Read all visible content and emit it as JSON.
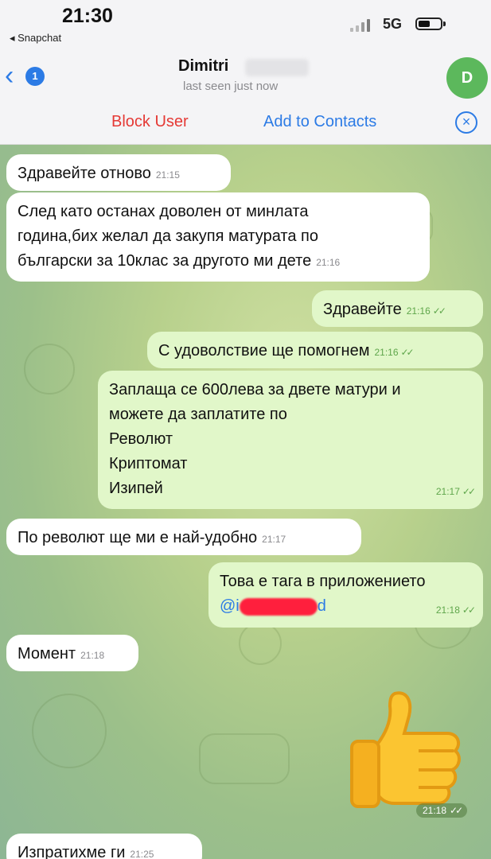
{
  "status_bar": {
    "time": "21:30",
    "back_app": "◂ Snapchat",
    "network": "5G"
  },
  "header": {
    "back_badge": "1",
    "contact_name": "Dimitri",
    "last_seen": "last seen just now",
    "avatar_initial": "D"
  },
  "actions": {
    "block_user": "Block User",
    "add_to_contacts": "Add to Contacts"
  },
  "messages": [
    {
      "direction": "in",
      "text": "Здравейте отново",
      "time": "21:15"
    },
    {
      "direction": "in",
      "lines": [
        "След като останах доволен от минлата",
        "година,бих желал да закупя матурата по",
        "български за 10клас за другото ми дете"
      ],
      "time": "21:16"
    },
    {
      "direction": "out",
      "text": "Здравейте",
      "time": "21:16"
    },
    {
      "direction": "out",
      "text": "С удоволствие ще помогнем",
      "time": "21:16"
    },
    {
      "direction": "out",
      "lines": [
        "Заплаща се 600лева за двете матури и",
        "можете да заплатите по",
        "Револют",
        "Криптомат",
        "Изипей"
      ],
      "time": "21:17"
    },
    {
      "direction": "in",
      "text": "По револют ще ми е най-удобно",
      "time": "21:17"
    },
    {
      "direction": "out",
      "lines": [
        "Това е тага в приложението"
      ],
      "mention_start": "@i",
      "mention_end": "d",
      "time": "21:18"
    },
    {
      "direction": "in",
      "text": "Момент",
      "time": "21:18"
    },
    {
      "direction": "out",
      "emoji": "👍",
      "time": "21:18"
    },
    {
      "direction": "in",
      "text": "Изпратихме ги",
      "time": "21:25"
    }
  ],
  "colors": {
    "accent": "#2c7be5",
    "danger": "#e53935",
    "outgoing_bubble": "#e1f7c9",
    "incoming_bubble": "#ffffff",
    "avatar": "#5cb85c",
    "redaction": "#ff1f3d"
  }
}
